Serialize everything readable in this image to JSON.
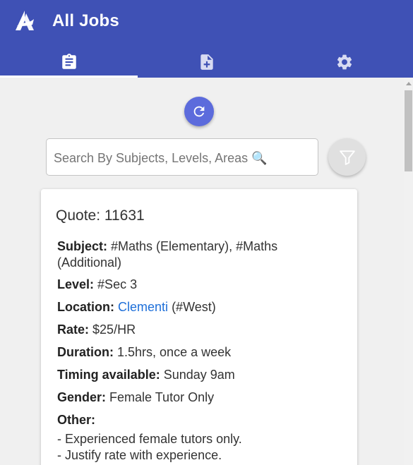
{
  "app": {
    "title": "All Jobs",
    "colors": {
      "primary": "#3f51b5",
      "refresh": "#5c6bdc",
      "link": "#1e6fd9"
    }
  },
  "tabs": [
    {
      "icon": "clipboard-list-icon",
      "active": true
    },
    {
      "icon": "add-document-icon",
      "active": false
    },
    {
      "icon": "gear-icon",
      "active": false
    }
  ],
  "search": {
    "placeholder": "Search By Subjects, Levels, Areas 🔍",
    "value": ""
  },
  "job": {
    "quote": "Quote: 11631",
    "subject_label": "Subject:",
    "subject_value": "#Maths (Elementary), #Maths (Additional)",
    "level_label": "Level:",
    "level_value": "#Sec 3",
    "location_label": "Location:",
    "location_link": "Clementi",
    "location_region": "(#West)",
    "rate_label": "Rate:",
    "rate_value": "$25/HR",
    "duration_label": "Duration:",
    "duration_value": "1.5hrs, once a week",
    "timing_label": "Timing available:",
    "timing_value": "Sunday 9am",
    "gender_label": "Gender:",
    "gender_value": "Female Tutor Only",
    "other_label": "Other:",
    "other_lines": [
      "- Experienced female tutors only.",
      "- Justify rate with experience."
    ]
  }
}
